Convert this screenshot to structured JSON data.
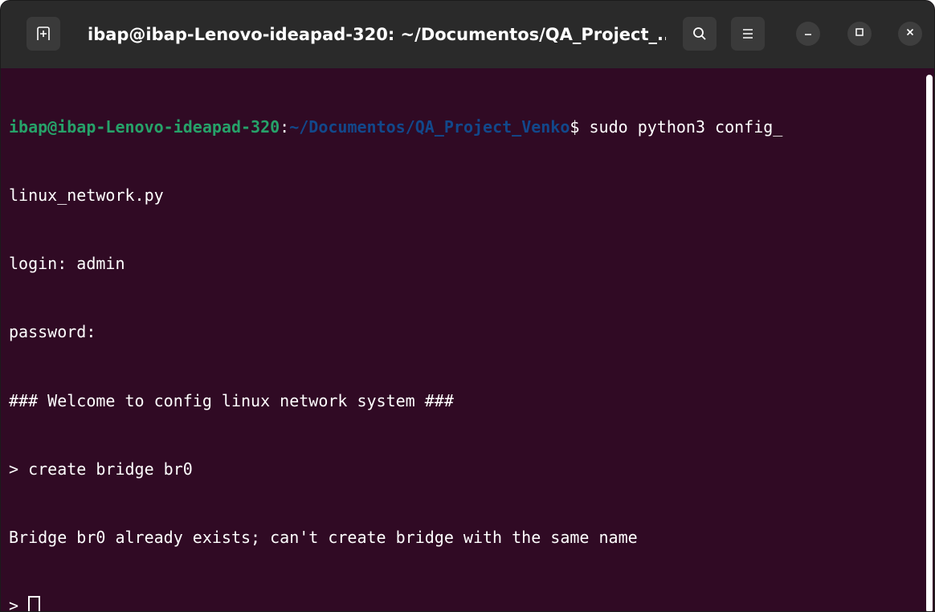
{
  "window": {
    "title": "ibap@ibap-Lenovo-ideapad-320: ~/Documentos/QA_Project_..."
  },
  "icons": {
    "new_tab": "new-tab-icon",
    "search": "search-icon",
    "menu": "hamburger-menu-icon",
    "minimize": "minimize-icon",
    "maximize": "maximize-icon",
    "close": "close-icon"
  },
  "colors": {
    "terminal_bg": "#300a24",
    "prompt_user": "#26a269",
    "prompt_path": "#12488b",
    "titlebar_bg": "#2a2a2a"
  },
  "terminal": {
    "prompt_user": "ibap@ibap-Lenovo-ideapad-320",
    "prompt_sep": ":",
    "prompt_path": "~/Documentos/QA_Project_Venko",
    "prompt_symbol": "$ ",
    "command_part1": "sudo python3 config_",
    "command_part2": "linux_network.py",
    "lines": [
      "login: admin",
      "password:",
      "### Welcome to config linux network system ###",
      "> create bridge br0",
      "Bridge br0 already exists; can't create bridge with the same name"
    ],
    "current_prompt": "> "
  }
}
